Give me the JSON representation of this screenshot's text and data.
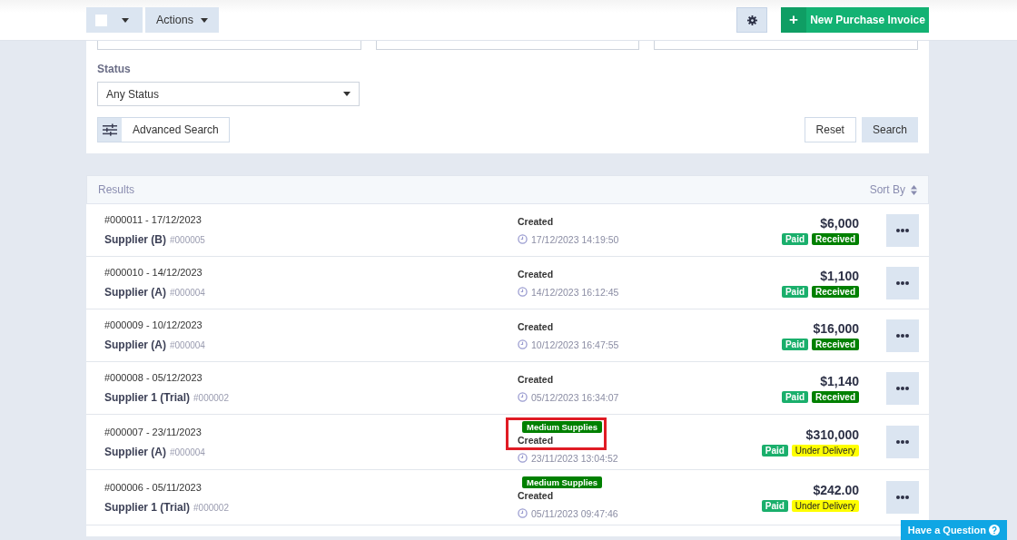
{
  "toolbar": {
    "select_checked": false,
    "actions_label": "Actions",
    "new_button": {
      "icon": "+",
      "label": "New Purchase Invoice"
    }
  },
  "filters": {
    "status_label": "Status",
    "status_value": "Any Status",
    "advanced_label": "Advanced Search",
    "reset_label": "Reset",
    "search_label": "Search"
  },
  "results": {
    "title": "Results",
    "sort_label": "Sort By",
    "rows": [
      {
        "number": "#000011 - 17/12/2023",
        "supplier": "Supplier (B)",
        "supplier_code": "#000005",
        "category": null,
        "status": "Created",
        "time": "17/12/2023 14:19:50",
        "amount": "$6,000",
        "highlighted": false,
        "tags": [
          {
            "label": "Paid",
            "color": "#1aaf6c"
          },
          {
            "label": "Received",
            "color": "#008000"
          }
        ]
      },
      {
        "number": "#000010 - 14/12/2023",
        "supplier": "Supplier (A)",
        "supplier_code": "#000004",
        "category": null,
        "status": "Created",
        "time": "14/12/2023 16:12:45",
        "amount": "$1,100",
        "highlighted": false,
        "tags": [
          {
            "label": "Paid",
            "color": "#1aaf6c"
          },
          {
            "label": "Received",
            "color": "#008000"
          }
        ]
      },
      {
        "number": "#000009 - 10/12/2023",
        "supplier": "Supplier (A)",
        "supplier_code": "#000004",
        "category": null,
        "status": "Created",
        "time": "10/12/2023 16:47:55",
        "amount": "$16,000",
        "highlighted": false,
        "tags": [
          {
            "label": "Paid",
            "color": "#1aaf6c"
          },
          {
            "label": "Received",
            "color": "#008000"
          }
        ]
      },
      {
        "number": "#000008 - 05/12/2023",
        "supplier": "Supplier 1 (Trial)",
        "supplier_code": "#000002",
        "category": null,
        "status": "Created",
        "time": "05/12/2023 16:34:07",
        "amount": "$1,140",
        "highlighted": false,
        "tags": [
          {
            "label": "Paid",
            "color": "#1aaf6c"
          },
          {
            "label": "Received",
            "color": "#008000"
          }
        ]
      },
      {
        "number": "#000007 - 23/11/2023",
        "supplier": "Supplier (A)",
        "supplier_code": "#000004",
        "category": "Medium Supplies",
        "status": "Created",
        "time": "23/11/2023 13:04:52",
        "amount": "$310,000",
        "highlighted": true,
        "tags": [
          {
            "label": "Paid",
            "color": "#1aaf6c"
          },
          {
            "label": "Under Delivery",
            "color": "#ffff00"
          }
        ]
      },
      {
        "number": "#000006 - 05/11/2023",
        "supplier": "Supplier 1 (Trial)",
        "supplier_code": "#000002",
        "category": "Medium Supplies",
        "status": "Created",
        "time": "05/11/2023 09:47:46",
        "amount": "$242.00",
        "highlighted": false,
        "tags": [
          {
            "label": "Paid",
            "color": "#1aaf6c"
          },
          {
            "label": "Under Delivery",
            "color": "#ffff00"
          }
        ]
      }
    ]
  },
  "help_button": {
    "label": "Have a Question"
  }
}
